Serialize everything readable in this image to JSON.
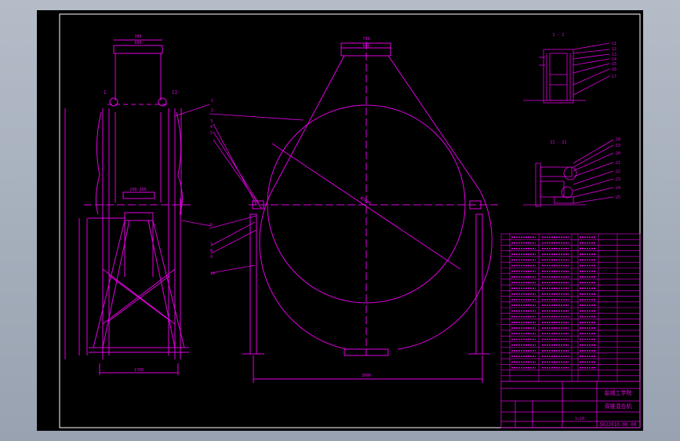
{
  "colors": {
    "background": "#000000",
    "line": "#e100e1",
    "frame": "#ffffff",
    "window": "#a8b0bc"
  },
  "section_labels": {
    "top": "I - I",
    "bottom": "II - II"
  },
  "side_view": {
    "label_left": "I",
    "label_right": "II",
    "width_top": "300",
    "width_top_inner": "600",
    "width_mid": "200  200",
    "base_width": "1700"
  },
  "front_view": {
    "top_width": "700",
    "top_inner": "600",
    "diameter": "Ø2800",
    "base_width": "3000"
  },
  "callouts": [
    "1",
    "2",
    "3",
    "4",
    "5",
    "6",
    "7",
    "8",
    "9",
    "10"
  ],
  "detail_callouts_top": [
    "11",
    "12",
    "13",
    "14",
    "15",
    "16",
    "17"
  ],
  "detail_callouts_bottom": [
    "18",
    "19",
    "20",
    "21",
    "22",
    "23",
    "24",
    "25"
  ],
  "title_block": {
    "school": "盐城工学院",
    "drawing_name": "双锥混合机",
    "drawing_number": "SHJ2010-00-00",
    "scale": "1:20"
  }
}
